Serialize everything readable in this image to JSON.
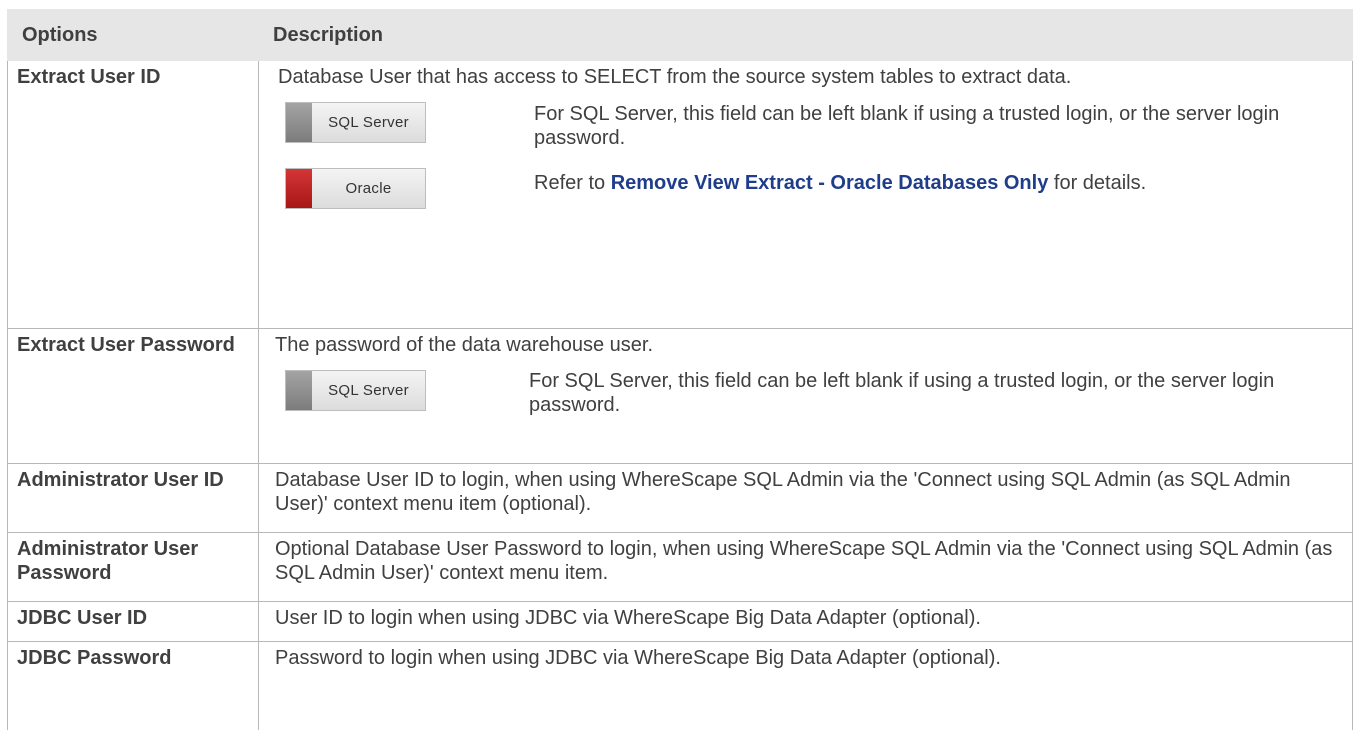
{
  "header": {
    "options": "Options",
    "description": "Description"
  },
  "rows": {
    "extract_user_id": {
      "option": "Extract User ID",
      "description": " Database User that has access to SELECT from the source system tables to extract data.",
      "sql_server": {
        "badge": "SQL Server",
        "text": " For SQL Server, this field can be left blank if using a trusted login, or the server login password."
      },
      "oracle": {
        "badge": "Oracle",
        "text_before": " Refer to ",
        "link": "Remove View Extract - Oracle Databases Only",
        "text_after": " for details."
      }
    },
    "extract_user_password": {
      "option": "Extract User Password",
      "description": "The password of the data warehouse user.",
      "sql_server": {
        "badge": "SQL Server",
        "text": "For SQL Server, this field can be left blank if using a trusted login, or the server login password."
      }
    },
    "administrator_user_id": {
      "option": "Administrator User ID",
      "description": "Database User ID to login, when using WhereScape SQL Admin via the 'Connect using SQL Admin (as SQL Admin User)' context menu item (optional)."
    },
    "administrator_user_password": {
      "option": "Administrator User Password",
      "description": "Optional Database User Password to login, when using WhereScape SQL Admin via the 'Connect using SQL Admin (as SQL Admin User)' context menu item."
    },
    "jdbc_user_id": {
      "option": "JDBC User ID",
      "description": "User ID to login when using JDBC via WhereScape Big Data Adapter (optional)."
    },
    "jdbc_password": {
      "option": "JDBC Password",
      "description": "Password to login when using JDBC via WhereScape Big Data Adapter (optional)."
    }
  },
  "colors": {
    "header_bg": "#e6e6e6",
    "text": "#404040",
    "link": "#1f3d8a",
    "sql_server_swatch": "#8c8c8c",
    "oracle_swatch": "#c02424"
  },
  "icons": {
    "sql_server": "sql-server-badge",
    "oracle": "oracle-badge"
  }
}
